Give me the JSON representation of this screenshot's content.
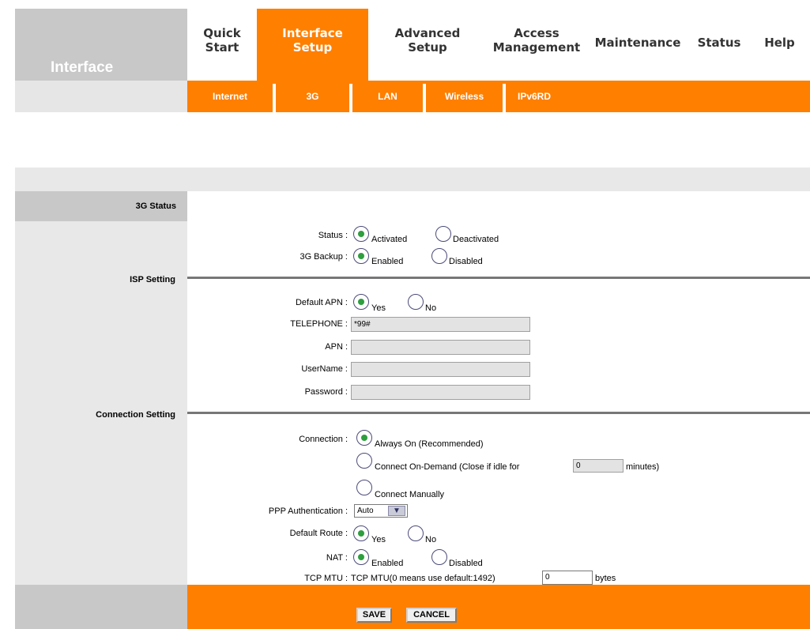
{
  "brand": {
    "title": "Interface"
  },
  "topnav": [
    {
      "label": "Quick\nStart",
      "active": false
    },
    {
      "label": "Interface\nSetup",
      "active": true
    },
    {
      "label": "Advanced\nSetup",
      "active": false
    },
    {
      "label": "Access\nManagement",
      "active": false
    },
    {
      "label": "Maintenance",
      "active": false
    },
    {
      "label": "Status",
      "active": false
    },
    {
      "label": "Help",
      "active": false
    }
  ],
  "subnav": [
    "Internet",
    "3G",
    "LAN",
    "Wireless",
    "IPv6RD"
  ],
  "sections": {
    "status": "3G Status",
    "isp": "ISP Setting",
    "connection": "Connection Setting"
  },
  "status": {
    "status_label": "Status :",
    "activated": "Activated",
    "deactivated": "Deactivated",
    "backup_label": "3G Backup :",
    "enabled": "Enabled",
    "disabled": "Disabled"
  },
  "isp": {
    "default_apn_label": "Default APN :",
    "yes": "Yes",
    "no": "No",
    "telephone_label": "TELEPHONE :",
    "telephone_value": "*99#",
    "apn_label": "APN :",
    "apn_value": "",
    "username_label": "UserName :",
    "username_value": "",
    "password_label": "Password :",
    "password_value": ""
  },
  "connection": {
    "connection_label": "Connection :",
    "always_on": "Always On (Recommended)",
    "on_demand_prefix": "Connect On-Demand (Close if idle for",
    "on_demand_value": "0",
    "on_demand_suffix": "minutes)",
    "manual": "Connect Manually",
    "ppp_label": "PPP Authentication :",
    "ppp_value": "Auto",
    "route_label": "Default Route :",
    "yes": "Yes",
    "no": "No",
    "nat_label": "NAT :",
    "enabled": "Enabled",
    "disabled": "Disabled",
    "mtu_label": "TCP MTU :",
    "mtu_hint": "TCP MTU(0 means use default:1492)",
    "mtu_value": "0",
    "mtu_unit": "bytes"
  },
  "buttons": {
    "save": "SAVE",
    "cancel": "CANCEL"
  },
  "colors": {
    "accent": "#ff7f00",
    "radio_dot": "#2e9e3e",
    "panel_gray": "#c8c8c8"
  }
}
